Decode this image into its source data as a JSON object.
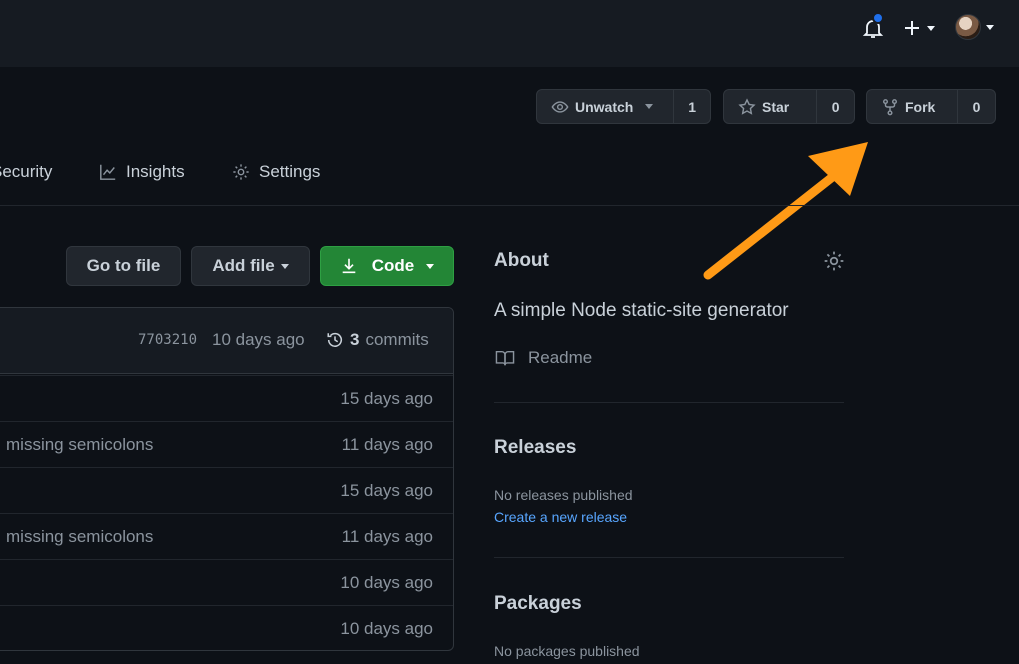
{
  "header": {
    "icons": {
      "bell": "bell-icon",
      "plus": "plus-icon",
      "avatar": "avatar"
    }
  },
  "repo_actions": {
    "unwatch": {
      "label": "Unwatch",
      "count": "1"
    },
    "star": {
      "label": "Star",
      "count": "0"
    },
    "fork": {
      "label": "Fork",
      "count": "0"
    }
  },
  "tabs": {
    "security": "Security",
    "insights": "Insights",
    "settings": "Settings"
  },
  "file_actions": {
    "goto_file": "Go to file",
    "add_file": "Add file",
    "code": "Code"
  },
  "commit_header": {
    "sha": "7703210",
    "ago": "10 days ago",
    "commits_count": "3",
    "commits_label": "commits"
  },
  "files": [
    {
      "message": "",
      "ago": "15 days ago"
    },
    {
      "message": "missing semicolons",
      "ago": "11 days ago"
    },
    {
      "message": "",
      "ago": "15 days ago"
    },
    {
      "message": "missing semicolons",
      "ago": "11 days ago"
    },
    {
      "message": "",
      "ago": "10 days ago"
    },
    {
      "message": "",
      "ago": "10 days ago"
    }
  ],
  "about": {
    "title": "About",
    "description": "A simple Node static-site generator",
    "readme": "Readme"
  },
  "releases": {
    "title": "Releases",
    "empty": "No releases published",
    "create_link": "Create a new release"
  },
  "packages": {
    "title": "Packages",
    "empty": "No packages published"
  },
  "colors": {
    "accent_blue": "#58a6ff",
    "code_green": "#238636",
    "annotation_orange": "#ff9a16",
    "notification_dot": "#1f6feb"
  }
}
